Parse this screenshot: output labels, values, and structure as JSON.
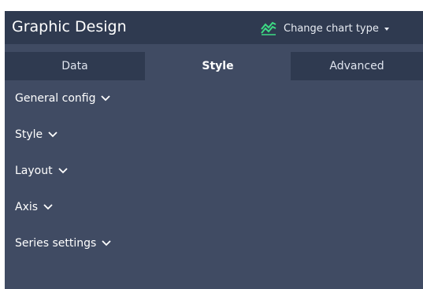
{
  "header": {
    "title": "Graphic Design",
    "change_chart_label": "Change chart type",
    "chart_icon": "line-chart-icon",
    "accent_color": "#3ddc84"
  },
  "tabs": [
    {
      "label": "Data",
      "active": false
    },
    {
      "label": "Style",
      "active": true
    },
    {
      "label": "Advanced",
      "active": false
    }
  ],
  "sections": [
    {
      "label": "General config"
    },
    {
      "label": "Style"
    },
    {
      "label": "Layout"
    },
    {
      "label": "Axis"
    },
    {
      "label": "Series settings"
    }
  ],
  "colors": {
    "panel_bg": "#404b63",
    "header_bg": "#2f3a50",
    "text": "#ffffff"
  }
}
